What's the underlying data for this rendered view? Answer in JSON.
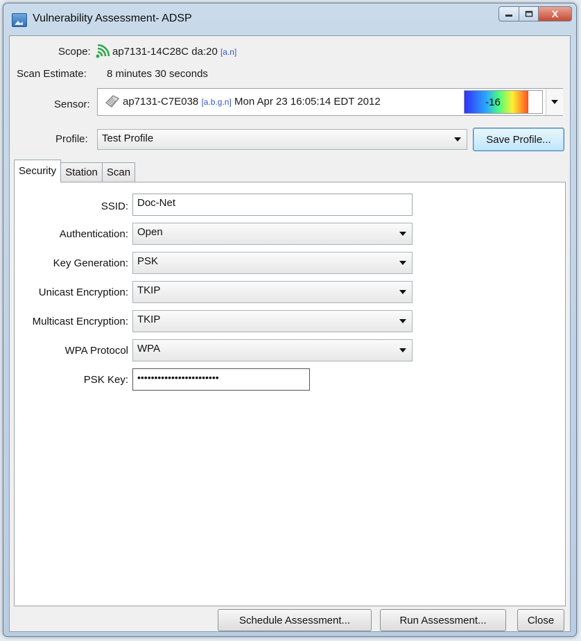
{
  "window": {
    "title": "Vulnerability Assessment- ADSP",
    "controls": {
      "minimize_icon": "minimize-icon",
      "maximize_icon": "maximize-icon",
      "close_label": "X"
    }
  },
  "header": {
    "scope_label": "Scope:",
    "scope_value": "ap7131-14C28C da:20",
    "scope_tag": "[a.n]",
    "scan_estimate_label": "Scan Estimate:",
    "scan_estimate_value": "8 minutes 30 seconds",
    "sensor_label": "Sensor:",
    "sensor_name": "ap7131-C7E038",
    "sensor_tag": "[a.b.g.n]",
    "sensor_date": "Mon Apr 23 16:05:14 EDT 2012",
    "sensor_signal": "-16",
    "profile_label": "Profile:",
    "profile_value": "Test Profile",
    "save_profile_label": "Save Profile..."
  },
  "tabs": [
    {
      "label": "Security",
      "active": true
    },
    {
      "label": "Station",
      "active": false
    },
    {
      "label": "Scan",
      "active": false
    }
  ],
  "security": {
    "ssid_label": "SSID:",
    "ssid_value": "Doc-Net",
    "authentication_label": "Authentication:",
    "authentication_value": "Open",
    "key_generation_label": "Key Generation:",
    "key_generation_value": "PSK",
    "unicast_label": "Unicast Encryption:",
    "unicast_value": "TKIP",
    "multicast_label": "Multicast Encryption:",
    "multicast_value": "TKIP",
    "wpa_protocol_label": "WPA Protocol",
    "wpa_protocol_value": "WPA",
    "psk_key_label": "PSK Key:",
    "psk_key_value": "••••••••••••••••••••••••"
  },
  "footer": {
    "schedule_label": "Schedule Assessment...",
    "run_label": "Run Assessment...",
    "close_label": "Close"
  },
  "colors": {
    "title_bar": "#c9daea",
    "close_button": "#c84a33",
    "tag_blue": "#3355cc"
  }
}
